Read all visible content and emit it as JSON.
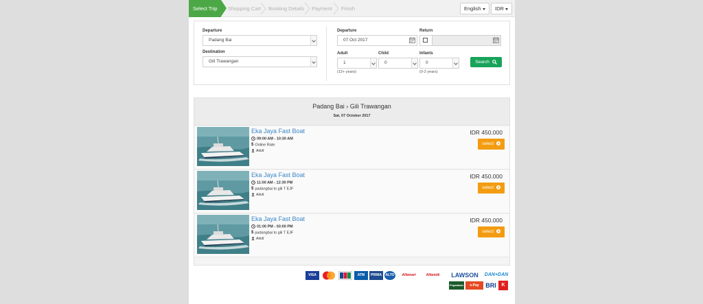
{
  "steps": [
    "Select Trip",
    "Shopping Cart",
    "Booking Details",
    "Payment",
    "Finish"
  ],
  "language": "English",
  "currency": "IDR",
  "search": {
    "departure_label": "Departure",
    "departure_value": "Padang Bai",
    "destination_label": "Destination",
    "destination_value": "Gili Trawangan",
    "dep_date_label": "Departure",
    "dep_date_value": "07  Oct  2017",
    "return_label": "Return",
    "adult_label": "Adult",
    "adult_value": "1",
    "adult_note": "(12+ years)",
    "child_label": "Child",
    "child_value": "0",
    "infants_label": "Infants",
    "infants_value": "0",
    "infants_note": "(0-2 years)",
    "search_button": "Search"
  },
  "route": {
    "title": "Padang Bai  ›  Gili Trawangan",
    "date": "Sat, 07 October 2017"
  },
  "trips": [
    {
      "name": "Eka Jaya Fast Boat",
      "time": "09:00 AM  -  10:30 AM",
      "info": "Online Rate",
      "pax": "Adult",
      "price": "IDR 450.000",
      "button": "select"
    },
    {
      "name": "Eka Jaya Fast Boat",
      "time": "11:00 AM  -  12:30 PM",
      "info": "padangbai to gili T EJF",
      "pax": "Adult",
      "price": "IDR 450.000",
      "button": "select"
    },
    {
      "name": "Eka Jaya Fast Boat",
      "time": "01:00 PM  -  03:00 PM",
      "info": "padangbai to gili T EJF",
      "pax": "Adult",
      "price": "IDR 450.000",
      "button": "select"
    }
  ],
  "payment_logos": [
    "VISA",
    "MasterCard",
    "JCB",
    "ATM Bersama",
    "PRIMA",
    "ALTO",
    "Alfamart",
    "Alfamidi",
    "LAWSON",
    "DAN+DAN",
    "Pegadaian",
    "e-Pay",
    "BRI",
    "Circle K"
  ],
  "colors": {
    "accent_green": "#4ca846",
    "search_green": "#18a35a",
    "select_orange": "#f39c12",
    "link_blue": "#3a87c7"
  }
}
